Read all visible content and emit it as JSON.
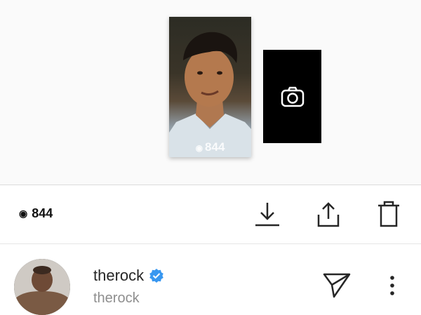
{
  "story": {
    "thumb_views": "844"
  },
  "stats": {
    "views": "844"
  },
  "viewer": {
    "username": "therock",
    "full_name": "therock",
    "verified": true
  },
  "icons": {
    "eye": "eye-icon",
    "camera": "camera-icon",
    "download": "download-icon",
    "share": "share-icon",
    "delete": "trash-icon",
    "send": "send-icon",
    "more": "more-vertical-icon",
    "verified": "verified-badge-icon"
  },
  "colors": {
    "verified_blue": "#3897f0",
    "text_primary": "#262626",
    "text_secondary": "#8e8e8e"
  }
}
